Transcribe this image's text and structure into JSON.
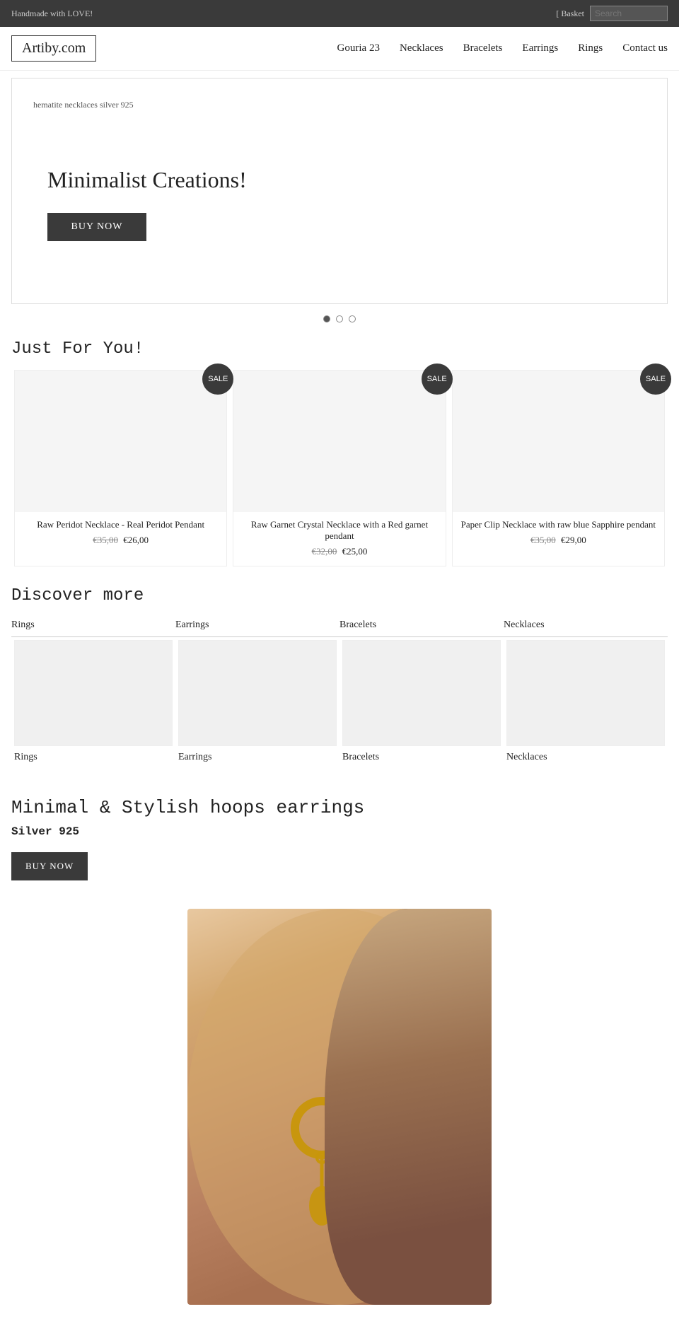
{
  "topbar": {
    "tagline": "Handmade with LOVE!",
    "basket_label": "[ Basket",
    "search_placeholder": "Search"
  },
  "header": {
    "logo": "Artiby.com",
    "nav": [
      {
        "label": "Gouria 23"
      },
      {
        "label": "Necklaces"
      },
      {
        "label": "Bracelets"
      },
      {
        "label": "Earrings"
      },
      {
        "label": "Rings"
      },
      {
        "label": "Contact us"
      }
    ]
  },
  "hero": {
    "search_hint": "hematite necklaces silver 925",
    "title": "Minimalist Creations!",
    "cta_label": "BUY NOW",
    "dots": [
      {
        "active": true
      },
      {
        "active": false
      },
      {
        "active": false
      }
    ]
  },
  "just_for_you": {
    "title": "Just For You!",
    "products": [
      {
        "name": "Raw Peridot Necklace - Real Peridot Pendant",
        "old_price": "€35,00",
        "new_price": "€26,00",
        "sale": "SALE"
      },
      {
        "name": "Raw Garnet Crystal Necklace with a Red garnet pendant",
        "old_price": "€32,00",
        "new_price": "€25,00",
        "sale": "SALE"
      },
      {
        "name": "Paper Clip Necklace with raw blue Sapphire pendant",
        "old_price": "€35,00",
        "new_price": "€29,00",
        "sale": "SALE"
      }
    ]
  },
  "discover_more": {
    "title": "Discover more",
    "tabs": [
      {
        "label": "Rings"
      },
      {
        "label": "Earrings"
      },
      {
        "label": "Bracelets"
      },
      {
        "label": "Necklaces"
      }
    ],
    "categories": [
      {
        "label": "Rings"
      },
      {
        "label": "Earrings"
      },
      {
        "label": "Bracelets"
      },
      {
        "label": "Necklaces"
      }
    ]
  },
  "earrings_promo": {
    "title": "Minimal & Stylish hoops earrings",
    "subtitle": "Silver 925",
    "cta_label": "BUY NOW"
  }
}
